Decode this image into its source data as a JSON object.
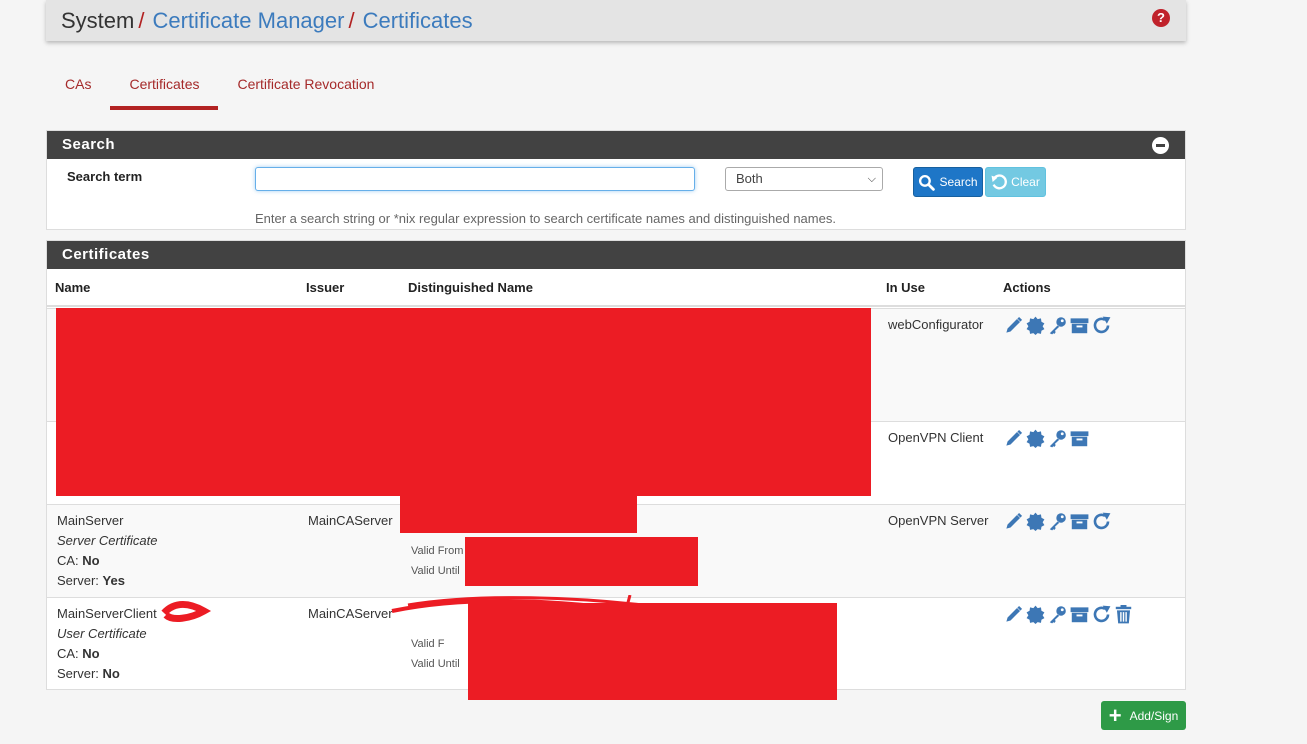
{
  "breadcrumb": {
    "root": "System",
    "sep": "/",
    "level1": "Certificate Manager",
    "level2": "Certificates"
  },
  "help_icon": "?",
  "tabs": [
    {
      "label": "CAs",
      "active": false
    },
    {
      "label": "Certificates",
      "active": true
    },
    {
      "label": "Certificate Revocation",
      "active": false
    }
  ],
  "search": {
    "title": "Search",
    "term_label": "Search term",
    "input_value": "",
    "input_placeholder": "",
    "scope_selected": "Both",
    "search_button": "Search",
    "clear_button": "Clear",
    "help_text": "Enter a search string or *nix regular expression to search certificate names and distinguished names."
  },
  "certificates": {
    "title": "Certificates",
    "columns": [
      "Name",
      "Issuer",
      "Distinguished Name",
      "In Use",
      "Actions"
    ],
    "rows": [
      {
        "in_use": "webConfigurator",
        "actions": [
          "edit-icon",
          "export-cert-icon",
          "export-key-icon",
          "export-p12-icon",
          "renew-icon"
        ]
      },
      {
        "in_use": "OpenVPN Client",
        "actions": [
          "edit-icon",
          "export-cert-icon",
          "export-key-icon",
          "export-p12-icon"
        ]
      },
      {
        "name": "MainServer",
        "type": "Server Certificate",
        "ca_label": "CA:",
        "ca_value": "No",
        "server_label": "Server:",
        "server_value": "Yes",
        "issuer": "MainCAServer",
        "valid_from": "Valid From",
        "valid_until": "Valid Until",
        "in_use": "OpenVPN Server",
        "actions": [
          "edit-icon",
          "export-cert-icon",
          "export-key-icon",
          "export-p12-icon",
          "renew-icon"
        ]
      },
      {
        "name": "MainServerClient",
        "type": "User Certificate",
        "ca_label": "CA:",
        "ca_value": "No",
        "server_label": "Server:",
        "server_value": "No",
        "issuer": "MainCAServer",
        "valid_from": "Valid F",
        "valid_until": "Valid Until",
        "in_use": "",
        "actions": [
          "edit-icon",
          "export-cert-icon",
          "export-key-icon",
          "export-p12-icon",
          "renew-icon",
          "delete-icon"
        ]
      }
    ]
  },
  "add_button": "Add/Sign",
  "colors": {
    "accent_red": "#b22222",
    "link_blue": "#3c7bbd",
    "icon_blue": "#3d77b5",
    "redaction": "#ec1c24"
  }
}
